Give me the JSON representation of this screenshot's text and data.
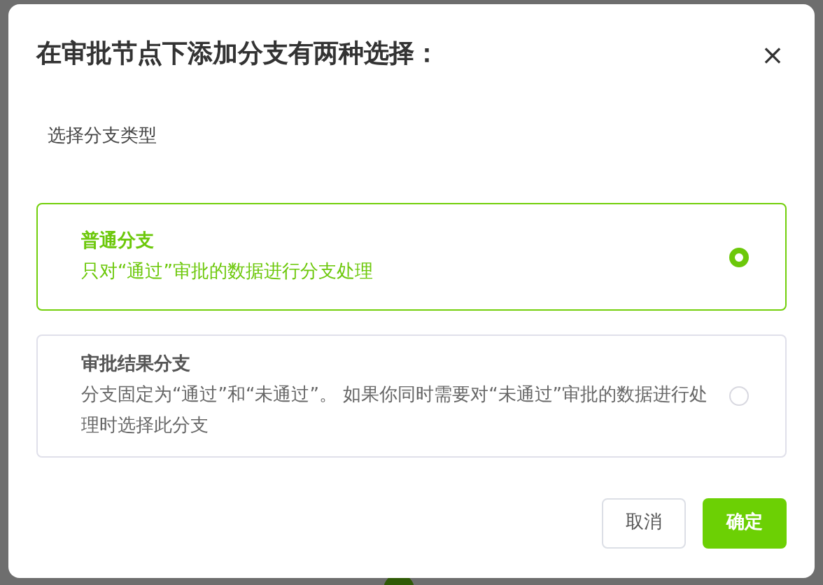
{
  "dialog": {
    "title": "在审批节点下添加分支有两种选择：",
    "close_icon": "×"
  },
  "section_label": "选择分支类型",
  "options": [
    {
      "title": "普通分支",
      "description": "只对“通过”审批的数据进行分支处理",
      "selected": true
    },
    {
      "title": "审批结果分支",
      "description": "分支固定为“通过”和“未通过”。 如果你同时需要对“未通过”审批的数据进行处理时选择此分支",
      "selected": false
    }
  ],
  "buttons": [
    {
      "label": "取消",
      "kind": "secondary"
    },
    {
      "label": "确定",
      "kind": "primary"
    }
  ]
}
